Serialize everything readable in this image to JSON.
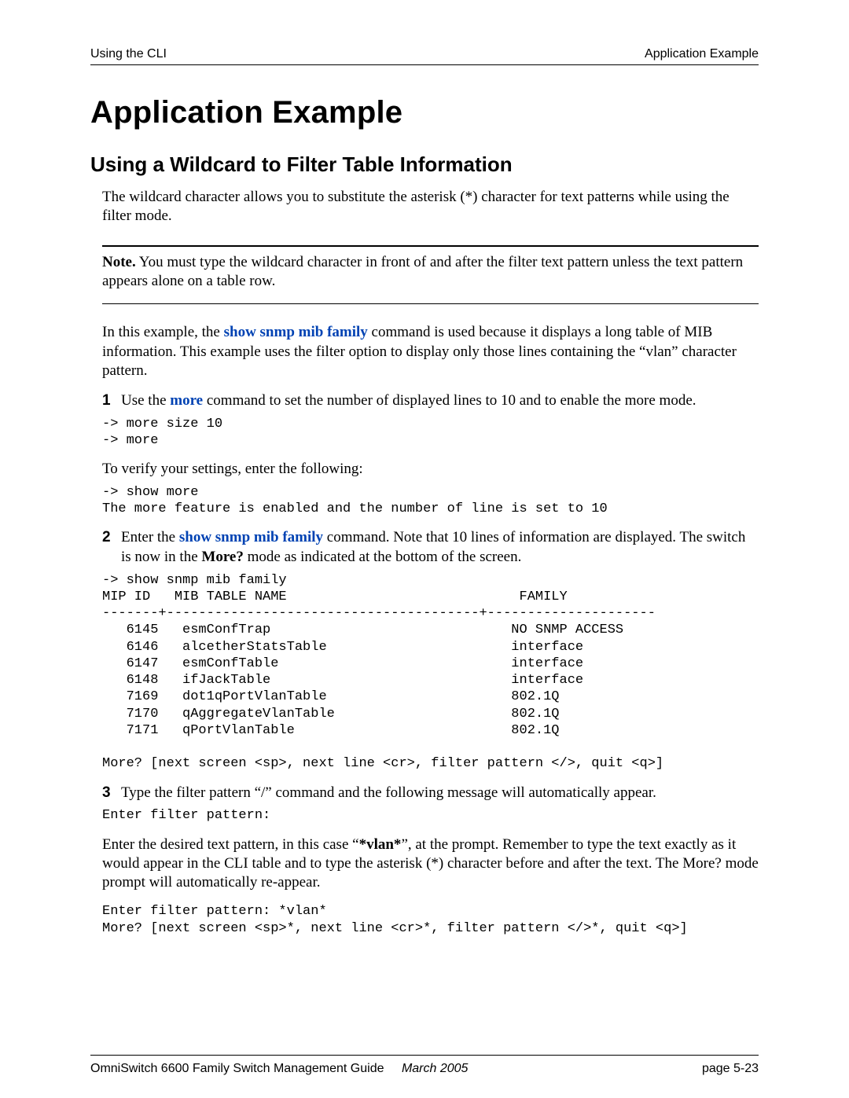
{
  "header": {
    "left": "Using the CLI",
    "right": "Application Example"
  },
  "title": "Application Example",
  "subtitle": "Using a Wildcard to Filter Table Information",
  "intro": "The wildcard character allows you to substitute the asterisk (*) character for text patterns while using the filter mode.",
  "note_label": "Note.",
  "note_text": " You must type the wildcard character in front of and after the filter text pattern unless the text pattern appears alone on a table row.",
  "example_pre": "In this example, the ",
  "cmd1": "show snmp mib family",
  "example_post": " command is used because it displays a long table of MIB information. This example uses the filter option to display only those lines containing the “vlan” character pattern.",
  "step1_num": "1",
  "step1_pre": "Use the ",
  "step1_cmd": "more",
  "step1_post": " command to set the number of displayed lines to 10 and to enable the more mode.",
  "code1": "-> more size 10\n-> more",
  "verify_text": "To verify your settings, enter the following:",
  "code2": "-> show more\nThe more feature is enabled and the number of line is set to 10",
  "step2_num": "2",
  "step2_pre": "Enter the ",
  "step2_cmd": "show snmp mib family",
  "step2_mid": " command. Note that 10 lines of information are displayed. The switch is now in the ",
  "step2_bold": "More?",
  "step2_post": " mode as indicated at the bottom of the screen.",
  "code3": "-> show snmp mib family\nMIP ID   MIB TABLE NAME                             FAMILY\n-------+---------------------------------------+---------------------\n   6145   esmConfTrap                              NO SNMP ACCESS\n   6146   alcetherStatsTable                       interface\n   6147   esmConfTable                             interface\n   6148   ifJackTable                              interface\n   7169   dot1qPortVlanTable                       802.1Q\n   7170   qAggregateVlanTable                      802.1Q\n   7171   qPortVlanTable                           802.1Q\n\nMore? [next screen <sp>, next line <cr>, filter pattern </>, quit <q>]",
  "step3_num": "3",
  "step3_text": "Type the filter pattern “/” command and the following message will automatically appear.",
  "code4": "Enter filter pattern:",
  "para2_pre": "Enter the desired text pattern, in this case “",
  "para2_bold": "*vlan*",
  "para2_post": "”, at the prompt. Remember to type the text exactly as it would appear in the CLI table and to type the asterisk (*) character before and after the text. The More? mode prompt will automatically re-appear.",
  "code5": "Enter filter pattern: *vlan*\nMore? [next screen <sp>*, next line <cr>*, filter pattern </>*, quit <q>]",
  "footer": {
    "guide": "OmniSwitch 6600 Family Switch Management Guide",
    "date": "March 2005",
    "page": "page 5-23"
  }
}
